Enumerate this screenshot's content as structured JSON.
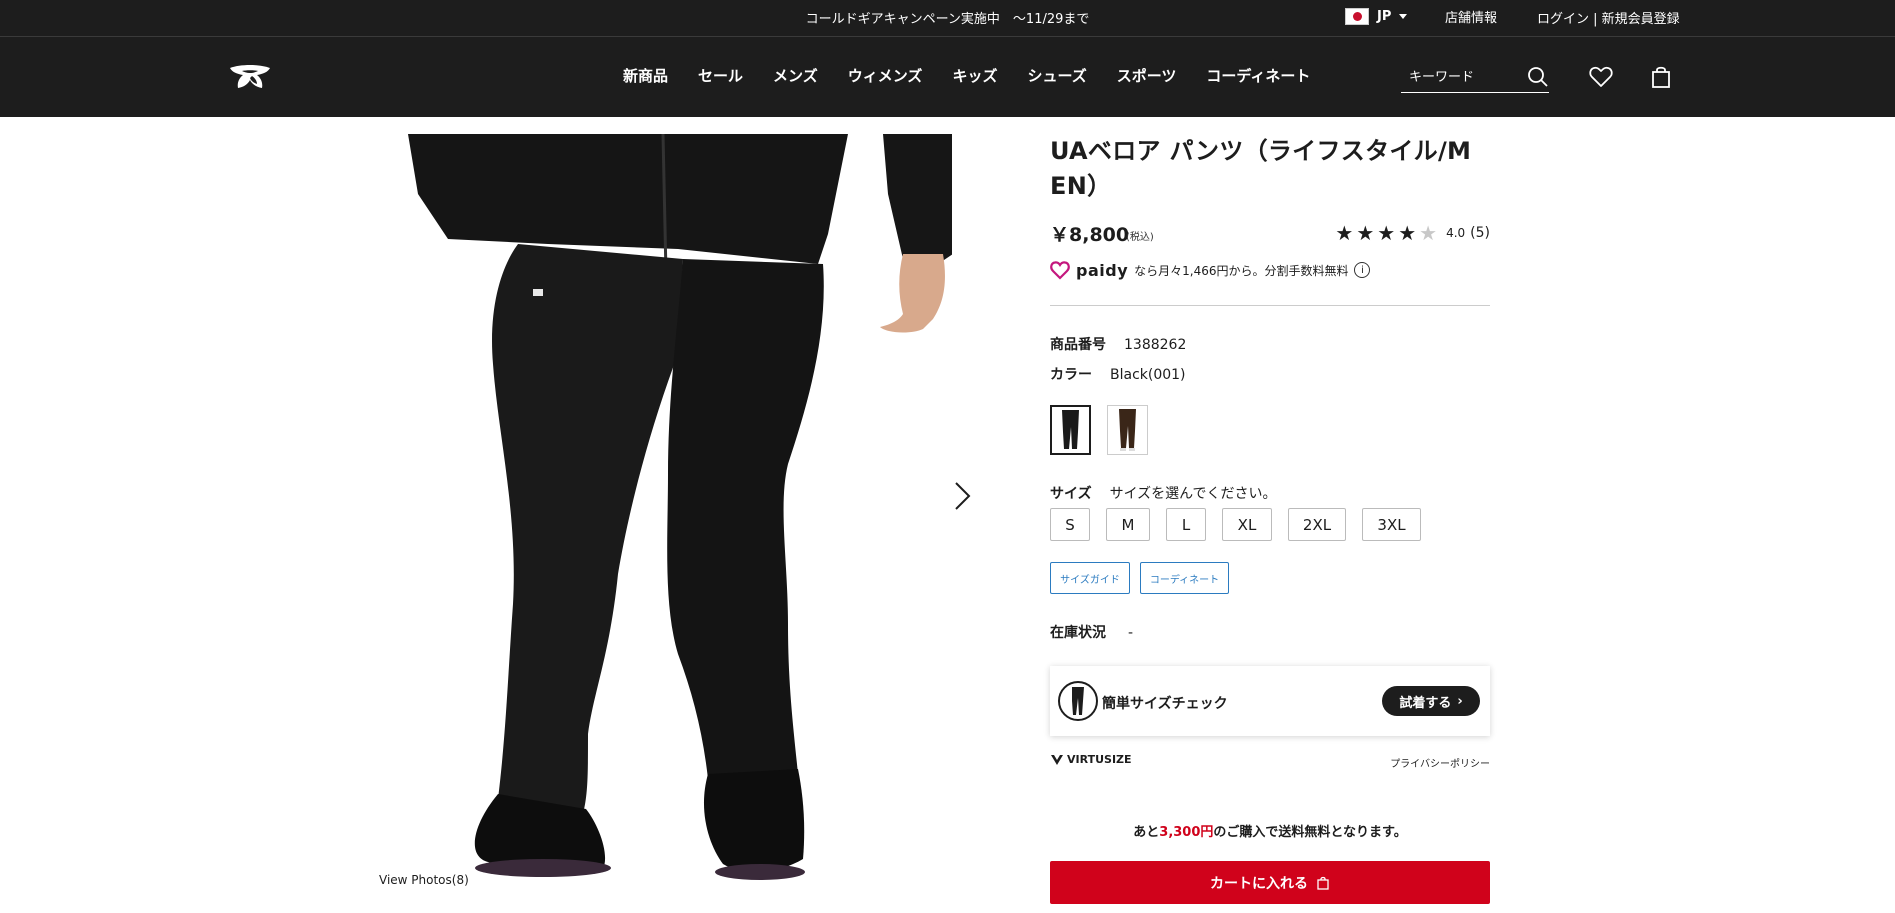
{
  "topbar": {
    "announcement": "コールドギアキャンペーン実施中　～11/29まで",
    "lang_code": "JP",
    "store_info": "店舗情報",
    "login_register": "ログイン | 新規会員登録"
  },
  "nav": {
    "items": [
      "新商品",
      "セール",
      "メンズ",
      "ウィメンズ",
      "キッズ",
      "シューズ",
      "スポーツ",
      "コーディネート"
    ]
  },
  "search": {
    "placeholder": "キーワード"
  },
  "gallery": {
    "view_photos": "View Photos(8)"
  },
  "product": {
    "title": "UAベロア パンツ（ライフスタイル/MEN）",
    "price": "￥8,800",
    "tax_note": "(税込)",
    "rating_value": "4.0",
    "rating_count": "(5)",
    "rating_stars": 4,
    "paidy_brand": "paidy",
    "paidy_text": "なら月々1,466円から。分割手数料無料",
    "sku_label": "商品番号",
    "sku": "1388262",
    "color_label": "カラー",
    "color_value": "Black(001)",
    "size_label": "サイズ",
    "size_prompt": "サイズを選んでください。",
    "sizes": [
      "S",
      "M",
      "L",
      "XL",
      "2XL",
      "3XL"
    ],
    "size_guide": "サイズガイド",
    "coordinate": "コーディネート",
    "stock_label": "在庫状況",
    "stock_value": "-"
  },
  "virtusize": {
    "check_text": "簡単サイズチェック",
    "try_button": "試着する",
    "brand": "VIRTUSIZE",
    "privacy": "プライバシーポリシー"
  },
  "shipping": {
    "prefix": "あと",
    "amount": "3,300円",
    "suffix": "のご購入で送料無料となります。"
  },
  "cart": {
    "label": "カートに入れる"
  },
  "colors": {
    "header_bg": "#1d1d1d",
    "accent_red": "#d0021b",
    "link_blue": "#2b7bc0"
  }
}
